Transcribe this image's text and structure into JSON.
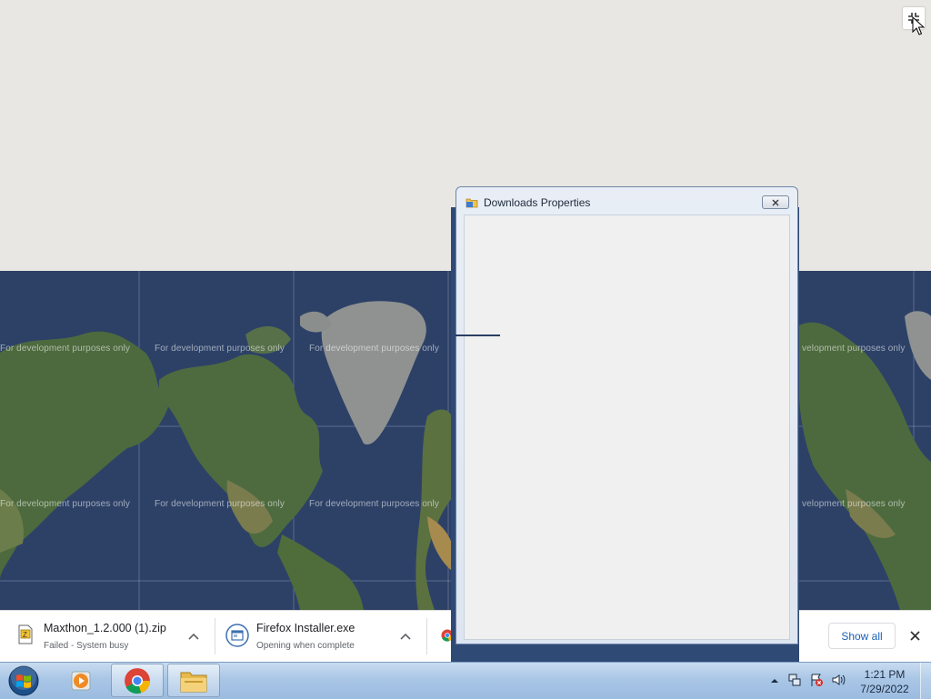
{
  "browser": {
    "exit_fullscreen_icon": "exit-fullscreen-icon",
    "cursor_icon": "arrow-cursor-icon"
  },
  "map": {
    "watermark_text": "For development purposes only",
    "watermark_partial": "velopment purposes only",
    "water_color": "#2d4167",
    "land_color": "#4d6a3e",
    "ice_color": "#8f9291"
  },
  "dialog": {
    "title": "Downloads Properties",
    "icon": "folder-icon",
    "close_icon": "close-icon"
  },
  "download_shelf": {
    "items": [
      {
        "name": "Maxthon_1.2.000 (1).zip",
        "status": "Failed - System busy",
        "icon": "zip-file-icon"
      },
      {
        "name": "Firefox Installer.exe",
        "status": "Opening when complete",
        "icon": "installer-icon"
      }
    ],
    "third_item_icon": "chrome-icon",
    "show_all_label": "Show all",
    "close_icon": "close-icon"
  },
  "taskbar": {
    "start_icon": "windows-start-icon",
    "apps": [
      {
        "name": "Windows Media Player",
        "icon": "media-player-icon"
      },
      {
        "name": "Google Chrome",
        "icon": "chrome-icon"
      },
      {
        "name": "Windows Explorer",
        "icon": "folder-icon"
      }
    ],
    "tray_icons": [
      "show-hidden-icons-icon",
      "network-icon",
      "action-center-icon",
      "volume-icon"
    ],
    "time": "1:21 PM",
    "date": "7/29/2022"
  }
}
